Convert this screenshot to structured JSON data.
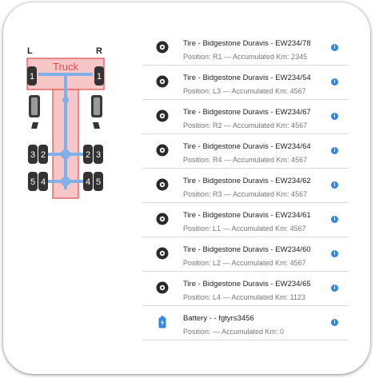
{
  "diagram": {
    "vehicle_label": "Truck",
    "left_label": "L",
    "right_label": "R",
    "wheel_numbers": [
      "1",
      "1",
      "2",
      "3",
      "2",
      "3",
      "4",
      "5",
      "4",
      "5"
    ]
  },
  "items": [
    {
      "icon": "tire-icon",
      "title": "Tire - Bidgestone Duravis - EW234/78",
      "subtitle": "Position: R1 — Accumulated Km: 2345"
    },
    {
      "icon": "tire-icon",
      "title": "Tire - Bidgestone Duravis - EW234/54",
      "subtitle": "Position: L3 — Accumulated Km: 4567"
    },
    {
      "icon": "tire-icon",
      "title": "Tire - Bidgestone Duravis - EW234/67",
      "subtitle": "Position: R2 — Accumulated Km: 4567"
    },
    {
      "icon": "tire-icon",
      "title": "Tire - Bidgestone Duravis - EW234/64",
      "subtitle": "Position: R4 — Accumulated Km: 4567"
    },
    {
      "icon": "tire-icon",
      "title": "Tire - Bidgestone Duravis - EW234/62",
      "subtitle": "Position: R3 — Accumulated Km: 4567"
    },
    {
      "icon": "tire-icon",
      "title": "Tire - Bidgestone Duravis - EW234/61",
      "subtitle": "Position: L1 — Accumulated Km: 4567"
    },
    {
      "icon": "tire-icon",
      "title": "Tire - Bidgestone Duravis - EW234/60",
      "subtitle": "Position: L2 — Accumulated Km: 4567"
    },
    {
      "icon": "tire-icon",
      "title": "Tire - Bidgestone Duravis - EW234/65",
      "subtitle": "Position: L4 — Accumulated Km: 1123"
    },
    {
      "icon": "battery-icon",
      "title": "Battery - - fgtyrs3456",
      "subtitle": "Position: — Accumulated Km: 0"
    }
  ],
  "colors": {
    "accent": "#2f86e6",
    "truck_outline": "#e34b4b",
    "truck_fill": "#f7c7c7",
    "axle": "#7fb0e8"
  }
}
